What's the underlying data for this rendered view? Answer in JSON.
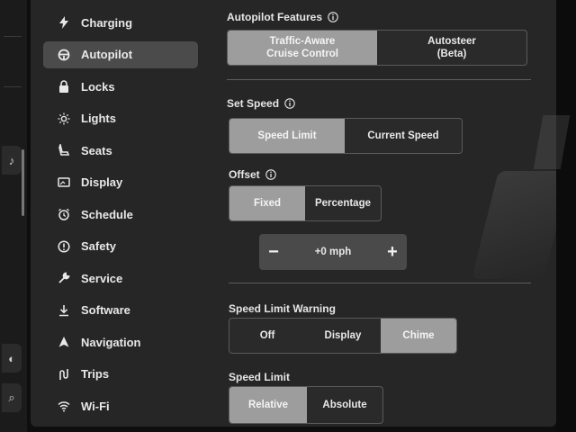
{
  "sidebar": {
    "items": [
      {
        "label": "Charging",
        "icon": "bolt-icon"
      },
      {
        "label": "Autopilot",
        "icon": "steering-wheel-icon",
        "active": true
      },
      {
        "label": "Locks",
        "icon": "lock-icon"
      },
      {
        "label": "Lights",
        "icon": "sun-icon"
      },
      {
        "label": "Seats",
        "icon": "seat-icon"
      },
      {
        "label": "Display",
        "icon": "display-icon"
      },
      {
        "label": "Schedule",
        "icon": "alarm-clock-icon"
      },
      {
        "label": "Safety",
        "icon": "alert-circle-icon"
      },
      {
        "label": "Service",
        "icon": "wrench-icon"
      },
      {
        "label": "Software",
        "icon": "download-icon"
      },
      {
        "label": "Navigation",
        "icon": "navigation-arrow-icon"
      },
      {
        "label": "Trips",
        "icon": "trips-icon"
      },
      {
        "label": "Wi-Fi",
        "icon": "wifi-icon"
      }
    ]
  },
  "autopilot_features": {
    "title": "Autopilot Features",
    "options": [
      "Traffic-Aware\nCruise Control",
      "Autosteer\n(Beta)"
    ],
    "selected": 0
  },
  "set_speed": {
    "title": "Set Speed",
    "options": [
      "Speed Limit",
      "Current Speed"
    ],
    "selected": 0
  },
  "offset": {
    "title": "Offset",
    "options": [
      "Fixed",
      "Percentage"
    ],
    "selected": 0,
    "stepper": {
      "minus": "−",
      "value": "+0 mph",
      "plus": "+"
    }
  },
  "speed_limit_warning": {
    "title": "Speed Limit Warning",
    "options": [
      "Off",
      "Display",
      "Chime"
    ],
    "selected": 2
  },
  "speed_limit": {
    "title": "Speed Limit",
    "options": [
      "Relative",
      "Absolute"
    ],
    "selected": 0
  },
  "colors": {
    "panel": "#262627",
    "selected": "#9d9d9d",
    "active_nav": "#4b4b4c"
  }
}
